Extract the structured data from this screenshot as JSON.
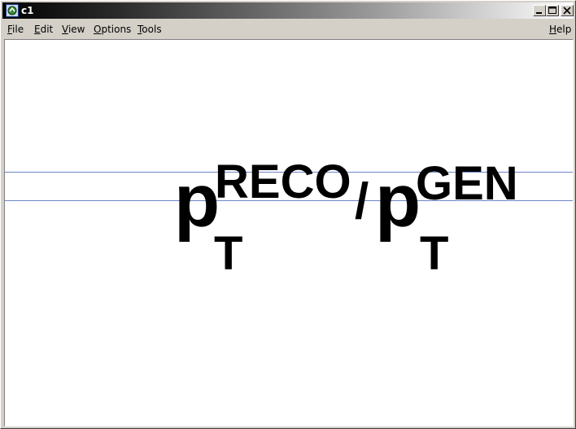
{
  "window": {
    "title": "c1",
    "icons": {
      "app": "root-canvas-icon",
      "minimize": "minimize-icon",
      "maximize": "maximize-icon",
      "close": "close-icon"
    }
  },
  "menu": {
    "file": "File",
    "edit": "Edit",
    "view": "View",
    "options": "Options",
    "tools": "Tools",
    "help": "Help"
  },
  "canvas": {
    "formula": {
      "p1": "p",
      "sup1": "RECO",
      "sub1": "T",
      "slash": "/",
      "p2": "p",
      "sup2": "GEN",
      "sub2": "T"
    },
    "guide_color": "#6e86c8"
  }
}
